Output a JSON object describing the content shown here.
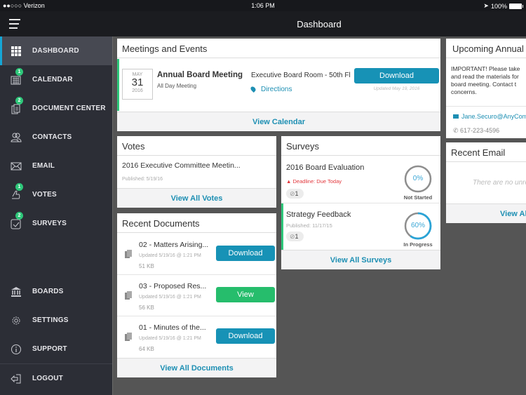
{
  "status_bar": {
    "carrier": "●●○○○ Verizon",
    "wifi": "wifi-icon",
    "time": "1:06 PM",
    "battery": "100%"
  },
  "header": {
    "title": "Dashboard"
  },
  "sidebar": {
    "items": [
      {
        "label": "DASHBOARD",
        "icon": "grid-icon",
        "badge": null,
        "active": true
      },
      {
        "label": "CALENDAR",
        "icon": "calendar-icon",
        "badge": "1"
      },
      {
        "label": "DOCUMENT CENTER",
        "icon": "documents-icon",
        "badge": "2"
      },
      {
        "label": "CONTACTS",
        "icon": "contacts-icon",
        "badge": null
      },
      {
        "label": "EMAIL",
        "icon": "email-icon",
        "badge": null
      },
      {
        "label": "VOTES",
        "icon": "votes-icon",
        "badge": "1"
      },
      {
        "label": "SURVEYS",
        "icon": "surveys-icon",
        "badge": "2"
      }
    ],
    "bottom_items": [
      {
        "label": "BOARDS",
        "icon": "boards-icon"
      },
      {
        "label": "SETTINGS",
        "icon": "gear-icon"
      },
      {
        "label": "SUPPORT",
        "icon": "info-icon"
      },
      {
        "label": "LOGOUT",
        "icon": "logout-icon"
      }
    ]
  },
  "meetings": {
    "title": "Meetings and Events",
    "event": {
      "month": "MAY",
      "day": "31",
      "year": "2016",
      "name": "Annual Board Meeting",
      "subtitle": "All Day Meeting",
      "location": "Executive Board Room - 50th Fl",
      "directions": "Directions",
      "download": "Download",
      "updated": "Updated May 19, 2016"
    },
    "footer": "View Calendar"
  },
  "votes": {
    "title": "Votes",
    "items": [
      {
        "name": "2016 Executive Committee Meetin...",
        "published": "Published: 5/19/16"
      }
    ],
    "footer": "View All Votes"
  },
  "documents": {
    "title": "Recent Documents",
    "items": [
      {
        "name": "02 - Matters Arising...",
        "updated": "Updated 5/19/16 @ 1:21 PM",
        "size": "51 KB",
        "action": "Download"
      },
      {
        "name": "03 - Proposed Res...",
        "updated": "Updated 5/19/16 @ 1:21 PM",
        "size": "56 KB",
        "action": "View"
      },
      {
        "name": "01 - Minutes of the...",
        "updated": "Updated 5/19/16 @ 1:21 PM",
        "size": "64 KB",
        "action": "Download"
      }
    ],
    "footer": "View All Documents"
  },
  "surveys": {
    "title": "Surveys",
    "items": [
      {
        "name": "2016 Board Evaluation",
        "deadline": "Deadline: Due Today",
        "attachments": "1",
        "progress": 0,
        "progress_label": "0%",
        "status": "Not Started"
      },
      {
        "name": "Strategy Feedback",
        "published": "Published: 11/17/15",
        "attachments": "1",
        "progress": 60,
        "progress_label": "60%",
        "status": "In Progress"
      }
    ],
    "footer": "View All Surveys"
  },
  "upcoming": {
    "title": "Upcoming Annual Board Meeting",
    "body_lines": [
      "IMPORTANT!  Please take",
      "and read the materials for",
      "board meeting.  Contact t",
      "concerns."
    ],
    "email": "Jane.Securo@AnyCompany",
    "phone": "617-223-4596"
  },
  "recent_email": {
    "title": "Recent Email",
    "empty": "There are no unread emails",
    "footer": "View All"
  },
  "colors": {
    "accent": "#1792b6",
    "green": "#26bd6c",
    "danger": "#e2373c",
    "sidebar": "#2c2e36",
    "active_indicator": "#15a6d6"
  }
}
